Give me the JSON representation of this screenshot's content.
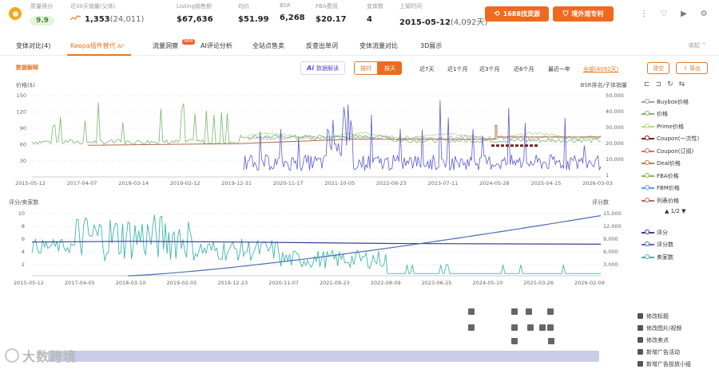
{
  "metrics": {
    "score": {
      "label": "质量得分",
      "value": "9.9"
    },
    "sales30": {
      "label": "近30天销量(父体)",
      "value": "1,353",
      "sub": "(24,011)"
    },
    "listing_sales": {
      "label": "Listing销售额",
      "value": "$67,636"
    },
    "avg_price": {
      "label": "均价",
      "value": "$51.99"
    },
    "bsr": {
      "label": "BSR",
      "value": "6,268"
    },
    "fba": {
      "label": "FBA费用",
      "value": "$20.17"
    },
    "variants": {
      "label": "变体数",
      "value": "4"
    },
    "launch": {
      "label": "上架时间",
      "value": "2015-05-12",
      "sub": "(4,092天)"
    }
  },
  "buttons": {
    "source_1688": "1688找货源",
    "overseas_patent": "境外观专利"
  },
  "tabs": [
    {
      "label": "变体对比(4)"
    },
    {
      "label": "Keepa插件替代",
      "ai": "AI⁺"
    },
    {
      "label": "流量洞察",
      "badge": "NEW"
    },
    {
      "label": "AI评论分析"
    },
    {
      "label": "全站点售卖"
    },
    {
      "label": "反查出单词"
    },
    {
      "label": "变体流量对比"
    },
    {
      "label": "3D展示"
    }
  ],
  "collapse_label": "收起 ^",
  "toolbar": {
    "data_explain": "数据解释",
    "ai_read": {
      "ai": "Ai",
      "label": "数据解读"
    },
    "by_hour": "按时",
    "by_day": "按天",
    "ranges": [
      "近7天",
      "近1个月",
      "近3个月",
      "近6个月",
      "最近一年",
      "全部(4092天)"
    ],
    "clear": "清空",
    "export": "导出"
  },
  "colors": {
    "accent": "#ef6a1f",
    "buybox": "#9aa0a6",
    "price": "#79b86a",
    "prime": "#a9d98a",
    "coupon_once": "#7a1f1f",
    "coupon_sub": "#d46e6e",
    "deal": "#d4762c",
    "fba": "#8db356",
    "fbm": "#5c9fd0",
    "list": "#b56d4c",
    "rank": "#5a5bd0",
    "rating": "#3d3f9a",
    "reviews": "#4a6fb0",
    "sellers": "#3fb6ae"
  },
  "chart1": {
    "left_label": "价格($)",
    "right_label": "BSR排名/子体销量",
    "y_ticks": [
      "150",
      "120",
      "90",
      "60",
      "30"
    ],
    "y_right_ticks": [
      "50,000",
      "40,000",
      "30,000",
      "20,000",
      "10,000",
      "1"
    ],
    "x_ticks": [
      "2015-05-12",
      "2017-04-07",
      "2018-03-14",
      "2019-02-12",
      "2019-12-31",
      "2020-11-17",
      "2021-10-05",
      "2022-08-23",
      "2023-07-11",
      "2024-05-28",
      "2025-04-15",
      "2026-03-03"
    ]
  },
  "chart2": {
    "left_label": "评分/卖家数",
    "right_label": "评分数",
    "y_ticks": [
      "10",
      "8",
      "6",
      "4",
      "2"
    ],
    "y_right_ticks": [
      "15,000",
      "12,000",
      "9,000",
      "6,000",
      "3,000"
    ],
    "x_ticks": [
      "2015-05-12",
      "2017-04-05",
      "2018-03-10",
      "2019-02-05",
      "2019-12-23",
      "2020-11-07",
      "2021-09-23",
      "2022-08-09",
      "2023-06-25",
      "2024-05-10",
      "2025-03-26",
      "2026-02-09"
    ]
  },
  "legend1": [
    {
      "label": "Buybox价格",
      "color": "#9aa0a6"
    },
    {
      "label": "价格",
      "color": "#79b86a"
    },
    {
      "label": "Prime价格",
      "color": "#a9d98a"
    },
    {
      "label": "Coupon(一次性)",
      "color": "#7a1f1f"
    },
    {
      "label": "Coupon(订阅)",
      "color": "#d46e6e"
    },
    {
      "label": "Deal价格",
      "color": "#d4762c"
    },
    {
      "label": "FBA价格",
      "color": "#8db356"
    },
    {
      "label": "FBM价格",
      "color": "#5c9fd0"
    },
    {
      "label": "列表价格",
      "color": "#b56d4c"
    }
  ],
  "legend_pager": "▲ 1/2 ▼",
  "legend2": [
    {
      "label": "评分",
      "color": "#3d3f9a"
    },
    {
      "label": "评分数",
      "color": "#4a6fb0"
    },
    {
      "label": "卖家数",
      "color": "#3fb6ae"
    }
  ],
  "side_actions": [
    "修改标题",
    "修改图片/视频",
    "修改卖点",
    "新增广告活动",
    "新增广告投放小组"
  ],
  "watermark": "大数跨境"
}
